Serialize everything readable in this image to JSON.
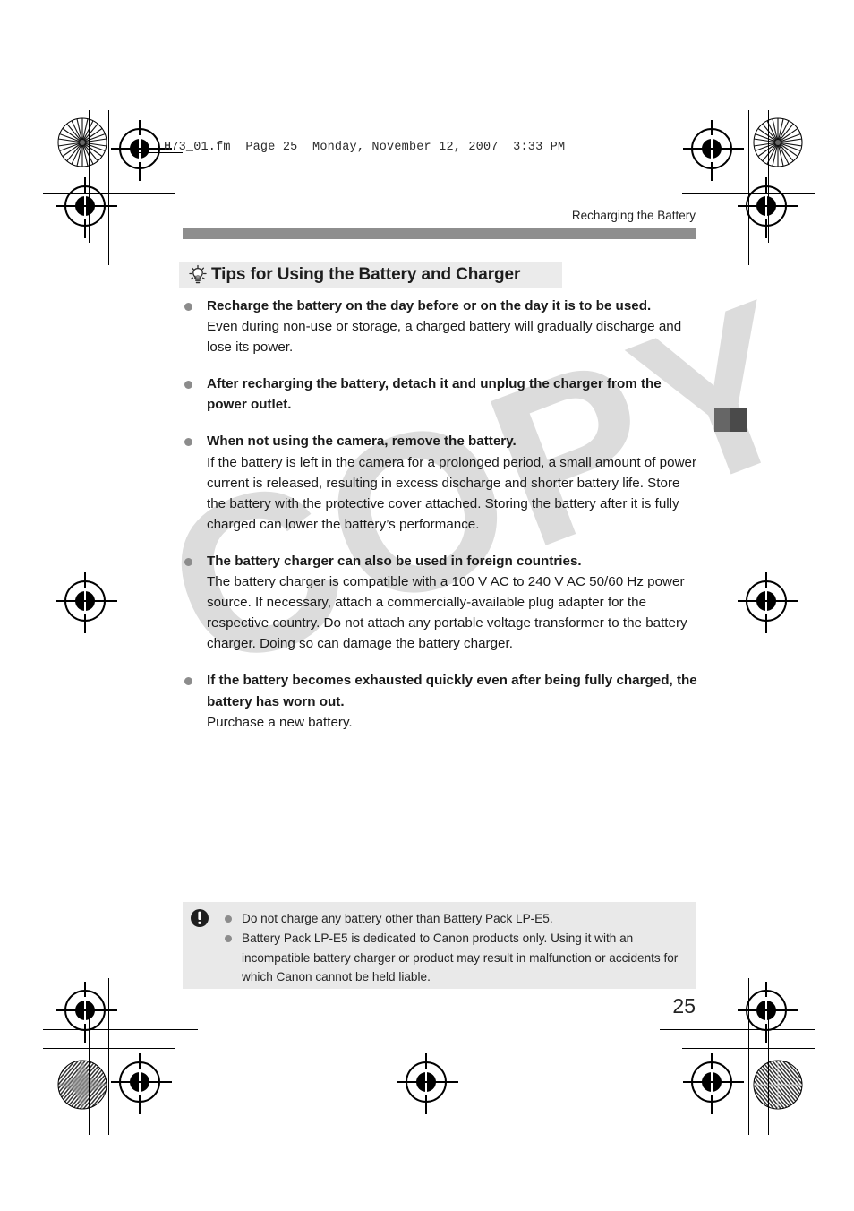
{
  "file_stamp": "H73_01.fm  Page 25  Monday, November 12, 2007  3:33 PM",
  "watermark": "COPY",
  "running_header": "Recharging the Battery",
  "section": {
    "icon": "lightbulb-tips-icon",
    "title": "Tips for Using the Battery and Charger"
  },
  "bullets": [
    {
      "heading": "Recharge the battery on the day before or on the day it is to be used.",
      "body": "Even during non-use or storage, a charged battery will gradually discharge and lose its power."
    },
    {
      "heading": "After recharging the battery, detach it and unplug the charger from the power outlet.",
      "body": ""
    },
    {
      "heading": "When not using the camera, remove the battery.",
      "body": "If the battery is left in the camera for a prolonged period, a small amount of power current is released, resulting in excess discharge and shorter battery life. Store the battery with the protective cover attached. Storing the battery after it is fully charged can lower the battery’s performance."
    },
    {
      "heading": "The battery charger can also be used in foreign countries.",
      "body": "The battery charger is compatible with a 100 V AC to 240 V AC 50/60 Hz power source. If necessary, attach a commercially-available plug adapter for the respective country. Do not attach any portable voltage transformer to the battery charger. Doing so can damage the battery charger."
    },
    {
      "heading": "If the battery becomes exhausted quickly even after being fully charged, the battery has worn out.",
      "body": "Purchase a new battery."
    }
  ],
  "note": {
    "icon": "caution-exclamation-icon",
    "items": [
      "Do not charge any battery other than Battery Pack LP-E5.",
      "Battery Pack LP-E5 is dedicated to Canon products only. Using it with an incompatible battery charger or product may result in malfunction or accidents for which Canon cannot be held liable."
    ]
  },
  "page_number": "25",
  "colors": {
    "header_bar": "#8e8e8e",
    "title_band": "#ebebeb",
    "note_bg": "#e9e9e9",
    "bullet_dot": "#8c8c8c",
    "watermark": "#dcdcdc",
    "tab_light": "#666666",
    "tab_dark": "#4a4a4a"
  }
}
